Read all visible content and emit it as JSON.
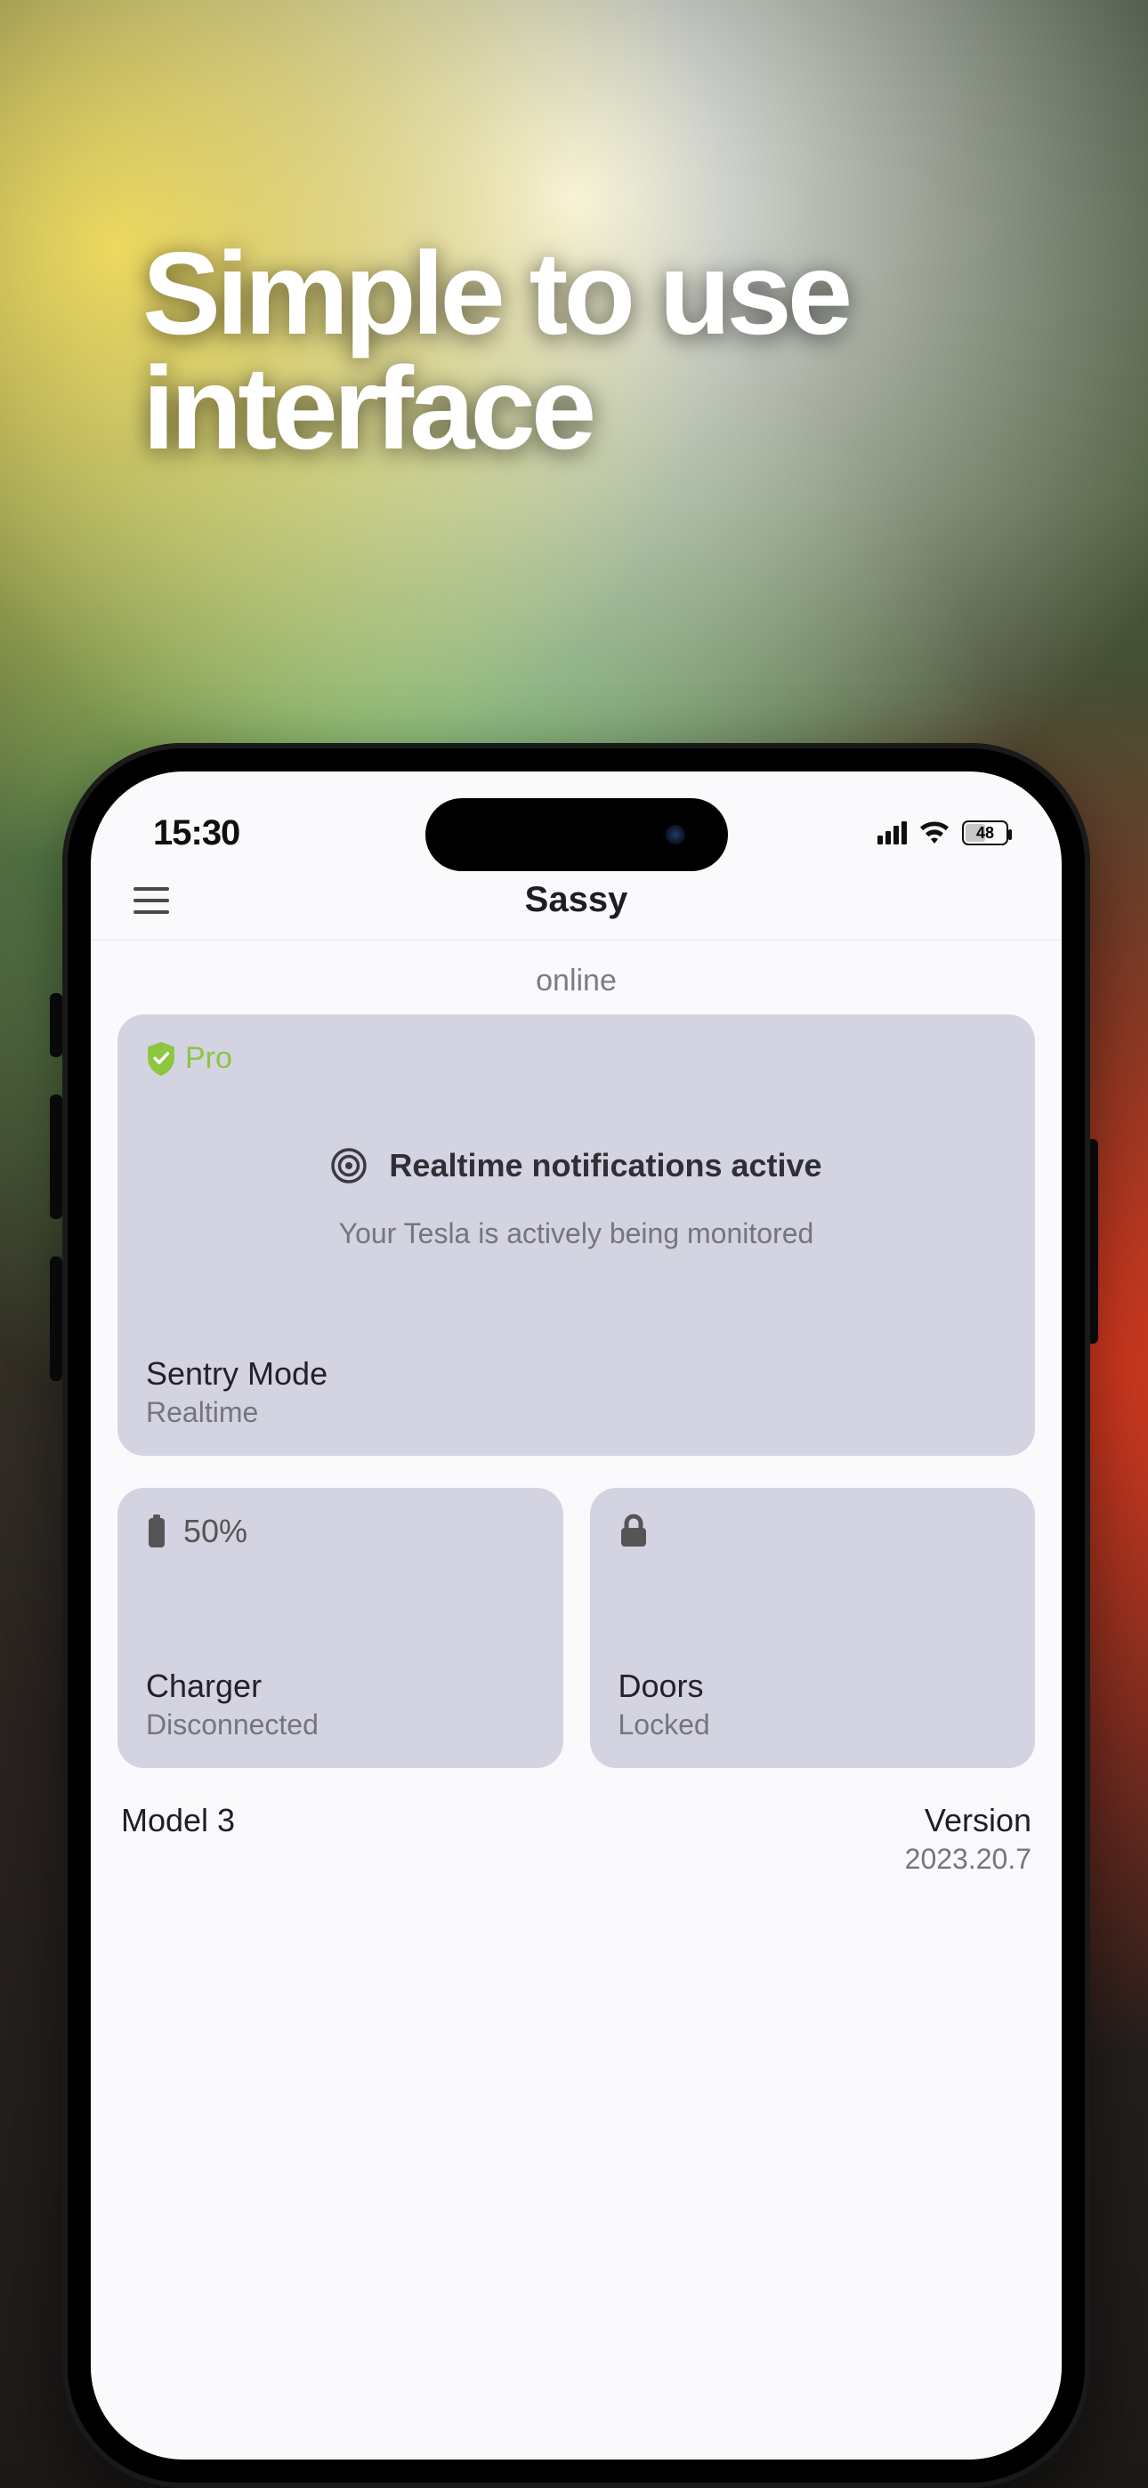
{
  "headline": "Simple to use interface",
  "status_bar": {
    "time": "15:30",
    "battery_label": "48"
  },
  "header": {
    "title": "Sassy"
  },
  "status_line": "online",
  "sentry_card": {
    "pro_label": "Pro",
    "notif_title": "Realtime notifications active",
    "notif_subtitle": "Your Tesla is actively being monitored",
    "footer_title": "Sentry Mode",
    "footer_subtitle": "Realtime"
  },
  "charger_tile": {
    "value": "50%",
    "title": "Charger",
    "subtitle": "Disconnected"
  },
  "doors_tile": {
    "title": "Doors",
    "subtitle": "Locked"
  },
  "info": {
    "model_label": "Model 3",
    "version_label": "Version",
    "version_value": "2023.20.7"
  }
}
